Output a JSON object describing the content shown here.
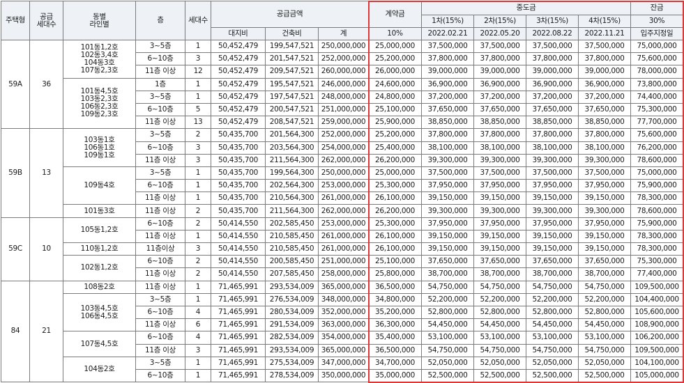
{
  "headers": {
    "type": "주택형",
    "supply_units": "공급\n세대수",
    "building_line": "동별\n라인별",
    "floor": "층",
    "units": "세대수",
    "supply_amount": "공급금액",
    "land": "대지비",
    "building": "건축비",
    "total": "계",
    "deposit": "계약금",
    "deposit_pct": "10%",
    "middle": "중도금",
    "m1": "1차(15%)",
    "m1_date": "2022.02.21",
    "m2": "2차(15%)",
    "m2_date": "2022.05.20",
    "m3": "3차(15%)",
    "m3_date": "2022.08.22",
    "m4": "4차(15%)",
    "m4_date": "2022.11.21",
    "balance": "잔금",
    "balance_pct": "30%",
    "balance_date": "입주지정일"
  },
  "groups": [
    {
      "type": "59A",
      "units": "36",
      "subgroups": [
        {
          "lines": [
            "101동1,2호",
            "102동3,4호",
            "104동3호",
            "107동2,3호"
          ],
          "rows": [
            [
              "3~5층",
              "1",
              "50,452,479",
              "199,547,521",
              "250,000,000",
              "25,000,000",
              "37,500,000",
              "37,500,000",
              "37,500,000",
              "37,500,000",
              "75,000,000"
            ],
            [
              "6~10층",
              "3",
              "50,452,479",
              "201,547,521",
              "252,000,000",
              "25,200,000",
              "37,800,000",
              "37,800,000",
              "37,800,000",
              "37,800,000",
              "75,600,000"
            ],
            [
              "11층 이상",
              "12",
              "50,452,479",
              "209,547,521",
              "260,000,000",
              "26,000,000",
              "39,000,000",
              "39,000,000",
              "39,000,000",
              "39,000,000",
              "78,000,000"
            ]
          ]
        },
        {
          "lines": [
            "101동4,5호",
            "103동2,3호",
            "106동2,3호",
            "109동2,3호"
          ],
          "rows": [
            [
              "1층",
              "1",
              "50,452,479",
              "195,547,521",
              "246,000,000",
              "24,600,000",
              "36,900,000",
              "36,900,000",
              "36,900,000",
              "36,900,000",
              "73,800,000"
            ],
            [
              "3~5층",
              "1",
              "50,452,479",
              "197,547,521",
              "248,000,000",
              "24,800,000",
              "37,200,000",
              "37,200,000",
              "37,200,000",
              "37,200,000",
              "74,400,000"
            ],
            [
              "6~10층",
              "5",
              "50,452,479",
              "200,547,521",
              "251,000,000",
              "25,100,000",
              "37,650,000",
              "37,650,000",
              "37,650,000",
              "37,650,000",
              "75,300,000"
            ],
            [
              "11층 이상",
              "13",
              "50,452,479",
              "208,547,521",
              "259,000,000",
              "25,900,000",
              "38,850,000",
              "38,850,000",
              "38,850,000",
              "38,850,000",
              "77,700,000"
            ]
          ]
        }
      ]
    },
    {
      "type": "59B",
      "units": "13",
      "subgroups": [
        {
          "lines": [
            "103동1호",
            "106동1호",
            "109동1호"
          ],
          "rows": [
            [
              "3~5층",
              "2",
              "50,435,700",
              "201,564,300",
              "252,000,000",
              "25,200,000",
              "37,800,000",
              "37,800,000",
              "37,800,000",
              "37,800,000",
              "75,600,000"
            ],
            [
              "6~10층",
              "3",
              "50,435,700",
              "203,564,300",
              "254,000,000",
              "25,400,000",
              "38,100,000",
              "38,100,000",
              "38,100,000",
              "38,100,000",
              "76,200,000"
            ],
            [
              "11층 이상",
              "3",
              "50,435,700",
              "211,564,300",
              "262,000,000",
              "26,200,000",
              "39,300,000",
              "39,300,000",
              "39,300,000",
              "39,300,000",
              "78,600,000"
            ]
          ]
        },
        {
          "lines": [
            "109동4호"
          ],
          "rows": [
            [
              "3~5층",
              "1",
              "50,435,700",
              "199,564,300",
              "250,000,000",
              "25,000,000",
              "37,500,000",
              "37,500,000",
              "37,500,000",
              "37,500,000",
              "75,000,000"
            ],
            [
              "6~10층",
              "1",
              "50,435,700",
              "202,564,300",
              "253,000,000",
              "25,300,000",
              "37,950,000",
              "37,950,000",
              "37,950,000",
              "37,950,000",
              "75,900,000"
            ],
            [
              "11층 이상",
              "1",
              "50,435,700",
              "210,564,300",
              "261,000,000",
              "26,100,000",
              "39,150,000",
              "39,150,000",
              "39,150,000",
              "39,150,000",
              "78,300,000"
            ]
          ]
        },
        {
          "lines": [
            "101동3호"
          ],
          "rows": [
            [
              "11층 이상",
              "2",
              "50,435,700",
              "211,564,300",
              "262,000,000",
              "26,200,000",
              "39,300,000",
              "39,300,000",
              "39,300,000",
              "39,300,000",
              "78,600,000"
            ]
          ]
        }
      ]
    },
    {
      "type": "59C",
      "units": "10",
      "subgroups": [
        {
          "lines": [
            "105동1,2호"
          ],
          "rows": [
            [
              "6~10층",
              "2",
              "50,414,550",
              "202,585,450",
              "253,000,000",
              "25,300,000",
              "37,950,000",
              "37,950,000",
              "37,950,000",
              "37,950,000",
              "75,900,000"
            ],
            [
              "11층 이상",
              "1",
              "50,414,550",
              "210,585,450",
              "261,000,000",
              "26,100,000",
              "39,150,000",
              "39,150,000",
              "39,150,000",
              "39,150,000",
              "78,300,000"
            ]
          ]
        },
        {
          "lines": [
            "110동1,2호"
          ],
          "rows": [
            [
              "11층이상",
              "3",
              "50,414,550",
              "210,585,450",
              "261,000,000",
              "26,100,000",
              "39,150,000",
              "39,150,000",
              "39,150,000",
              "39,150,000",
              "78,300,000"
            ]
          ]
        },
        {
          "lines": [
            "102동1,2호"
          ],
          "rows": [
            [
              "6~10층",
              "2",
              "50,414,550",
              "200,585,450",
              "251,000,000",
              "25,100,000",
              "37,650,000",
              "37,650,000",
              "37,650,000",
              "37,650,000",
              "75,300,000"
            ],
            [
              "11층 이상",
              "2",
              "50,414,550",
              "207,585,450",
              "258,000,000",
              "25,800,000",
              "38,700,000",
              "38,700,000",
              "38,700,000",
              "38,700,000",
              "77,400,000"
            ]
          ]
        }
      ]
    },
    {
      "type": "84",
      "units": "21",
      "subgroups": [
        {
          "lines": [
            "108동2호"
          ],
          "rows": [
            [
              "11층 이상",
              "1",
              "71,465,991",
              "293,534,009",
              "365,000,000",
              "36,500,000",
              "54,750,000",
              "54,750,000",
              "54,750,000",
              "54,750,000",
              "109,500,000"
            ]
          ]
        },
        {
          "lines": [
            "103동4,5호",
            "106동4,5호"
          ],
          "rows": [
            [
              "3~5층",
              "1",
              "71,465,991",
              "276,534,009",
              "348,000,000",
              "34,800,000",
              "52,200,000",
              "52,200,000",
              "52,200,000",
              "52,200,000",
              "104,400,000"
            ],
            [
              "6~10층",
              "4",
              "71,465,991",
              "280,534,009",
              "352,000,000",
              "35,200,000",
              "52,800,000",
              "52,800,000",
              "52,800,000",
              "52,800,000",
              "105,600,000"
            ],
            [
              "11층 이상",
              "6",
              "71,465,991",
              "291,534,009",
              "363,000,000",
              "36,300,000",
              "54,450,000",
              "54,450,000",
              "54,450,000",
              "54,450,000",
              "108,900,000"
            ]
          ]
        },
        {
          "lines": [
            "107동4,5호"
          ],
          "rows": [
            [
              "6~10층",
              "4",
              "71,465,991",
              "282,534,009",
              "354,000,000",
              "35,400,000",
              "53,100,000",
              "53,100,000",
              "53,100,000",
              "53,100,000",
              "106,200,000"
            ],
            [
              "11층 이상",
              "3",
              "71,465,991",
              "293,534,009",
              "365,000,000",
              "36,500,000",
              "54,750,000",
              "54,750,000",
              "54,750,000",
              "54,750,000",
              "109,500,000"
            ]
          ]
        },
        {
          "lines": [
            "104동2호"
          ],
          "rows": [
            [
              "3~5층",
              "1",
              "71,465,991",
              "275,534,009",
              "347,000,000",
              "34,700,000",
              "52,050,000",
              "52,050,000",
              "52,050,000",
              "52,050,000",
              "104,100,000"
            ],
            [
              "6~10층",
              "1",
              "71,465,991",
              "278,534,009",
              "350,000,000",
              "35,000,000",
              "52,500,000",
              "52,500,000",
              "52,500,000",
              "52,500,000",
              "105,000,000"
            ]
          ]
        }
      ]
    }
  ],
  "highlight_color": "#e23535"
}
